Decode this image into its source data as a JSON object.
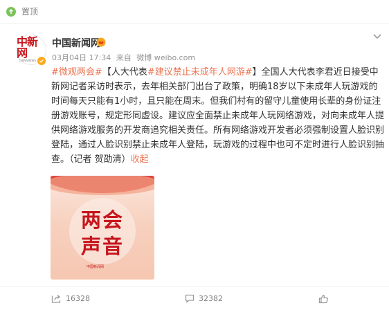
{
  "pin_label": "置顶",
  "user": {
    "name": "中国新闻网",
    "avatar_logo": "中新网",
    "avatar_url": "CHINANEWS.COM"
  },
  "meta": {
    "date": "03月04日 17:34",
    "source_prefix": "来自",
    "source": "微博 weibo.com"
  },
  "post": {
    "segments": [
      {
        "text": "#微观两会#",
        "link": true
      },
      {
        "text": "【人大代表",
        "link": false
      },
      {
        "text": "#建议禁止未成年人网游#",
        "link": true
      },
      {
        "text": "】全国人大代表李君近日接受中新网记者采访时表示，去年相关部门出台了政策，明确18岁以下未成年人玩游戏的时间每天只能有1小时，且只能在周末。但我们村有的留守儿童使用长辈的身份证注册游戏账号，规定形同虚设。建议应全面禁止未成年人玩网络游戏，对向未成年人提供网络游戏服务的开发商追究相关责任。所有网络游戏开发者必须强制设置人脸识别登陆，通过人脸识别禁止未成年人登陆，玩游戏的过程中也可不定时进行人脸识别抽查。（记者 贺劭清）",
        "link": false
      },
      {
        "text": "收起",
        "link": true
      }
    ]
  },
  "image": {
    "title_line1": "两会",
    "title_line2": "声音",
    "logo": "中国新闻网"
  },
  "actions": {
    "share": "16328",
    "comment": "32382"
  },
  "colors": {
    "link": "#eb7350",
    "brand_red": "#c6161e"
  }
}
